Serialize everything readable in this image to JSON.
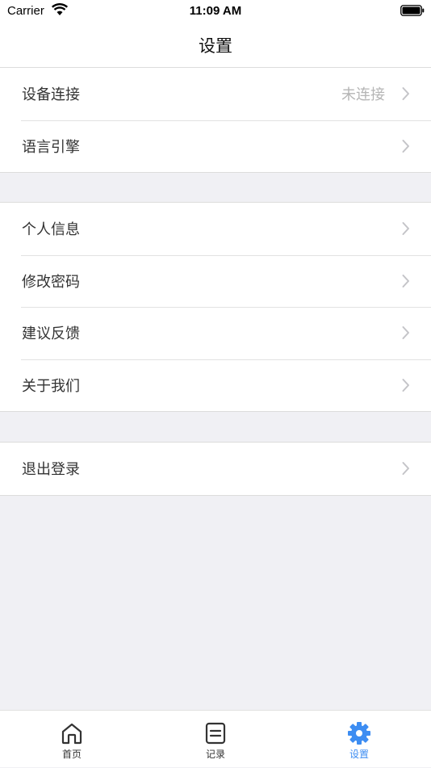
{
  "status_bar": {
    "carrier": "Carrier",
    "time": "11:09 AM"
  },
  "nav": {
    "title": "设置"
  },
  "groups": [
    {
      "items": [
        {
          "label": "设备连接",
          "value": "未连接"
        },
        {
          "label": "语言引擎",
          "value": ""
        }
      ]
    },
    {
      "items": [
        {
          "label": "个人信息"
        },
        {
          "label": "修改密码"
        },
        {
          "label": "建议反馈"
        },
        {
          "label": "关于我们"
        }
      ]
    },
    {
      "items": [
        {
          "label": "退出登录"
        }
      ]
    }
  ],
  "tab_bar": {
    "tabs": [
      {
        "label": "首页",
        "icon": "home-icon"
      },
      {
        "label": "记录",
        "icon": "record-icon"
      },
      {
        "label": "设置",
        "icon": "gear-icon"
      }
    ],
    "active_index": 2
  },
  "colors": {
    "accent": "#3d8df2",
    "background": "#f0f0f4",
    "value_text": "#b5b5b5"
  }
}
